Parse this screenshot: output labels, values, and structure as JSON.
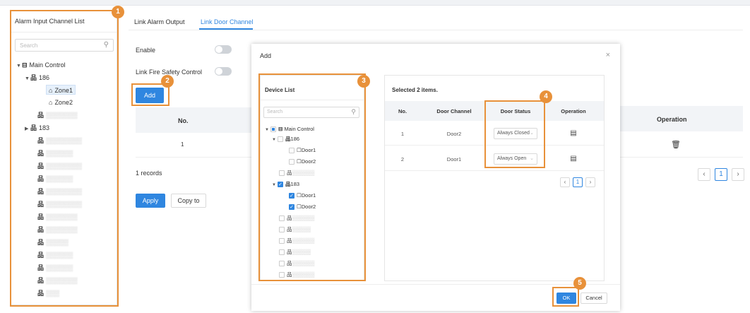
{
  "left_panel": {
    "title": "Alarm Input Channel List",
    "search_placeholder": "Search",
    "tree": {
      "root": "Main Control",
      "node_186": "186",
      "zone1": "Zone1",
      "zone2": "Zone2",
      "node_183": "183"
    }
  },
  "tabs": {
    "alarm_output": "Link Alarm Output",
    "door_channel": "Link Door Channel"
  },
  "config": {
    "enable_label": "Enable",
    "fire_label": "Link Fire Safety Control",
    "add_label": "Add",
    "col_no": "No.",
    "row_no": "1",
    "records": "1 records",
    "apply_label": "Apply",
    "copy_label": "Copy to",
    "operation_header": "Operation",
    "page_current": "1"
  },
  "modal": {
    "title": "Add",
    "close_icon": "×",
    "device_list_title": "Device List",
    "search_placeholder": "Search",
    "tree": {
      "root": "Main Control",
      "n186": "186",
      "door1": "Door1",
      "door2": "Door2",
      "n183": "183",
      "door1b": "Door1",
      "door2b": "Door2"
    },
    "selected_title": "Selected 2 items.",
    "headers": {
      "no": "No.",
      "channel": "Door Channel",
      "status": "Door Status",
      "op": "Operation"
    },
    "rows": [
      {
        "no": "1",
        "channel": "Door2",
        "status": "Always Closed"
      },
      {
        "no": "2",
        "channel": "Door1",
        "status": "Always Open"
      }
    ],
    "page_current": "1",
    "ok_label": "OK",
    "cancel_label": "Cancel"
  },
  "callouts": [
    "1",
    "2",
    "3",
    "4",
    "5"
  ],
  "colors": {
    "accent": "#2f86e0",
    "callout": "#e8913a"
  }
}
